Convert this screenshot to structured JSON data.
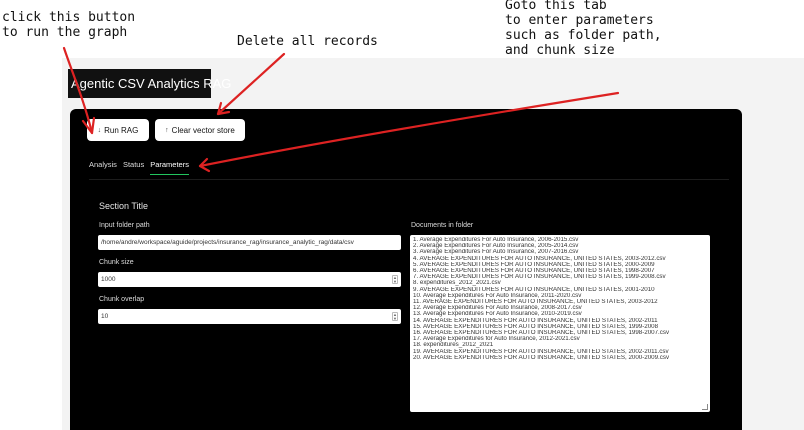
{
  "annotations": {
    "run": "click this button\nto run the graph",
    "delete": "Delete all records",
    "params": "Goto this tab\nto enter parameters\nsuch as folder path,\nand chunk size"
  },
  "app": {
    "title": "Agentic CSV Analytics RAG",
    "buttons": {
      "run_rag": "Run RAG",
      "run_rag_icon": "↓",
      "clear": "Clear vector store",
      "clear_icon": "↑"
    },
    "tabs": [
      {
        "label": "Analysis",
        "active": false
      },
      {
        "label": "Status",
        "active": false
      },
      {
        "label": "Parameters",
        "active": true
      }
    ],
    "section_title": "Section Title",
    "fields": {
      "folder_label": "Input folder path",
      "folder_value": "/home/andre/workspace/aguide/projects/insurance_rag/insurance_analytic_rag/data/csv",
      "chunk_size_label": "Chunk size",
      "chunk_size_value": "1000",
      "chunk_overlap_label": "Chunk overlap",
      "chunk_overlap_value": "10"
    },
    "documents_label": "Documents in folder",
    "documents": [
      "1. Average Expenditures For Auto Insurance, 2006-2015.csv",
      "2. Average Expenditures For Auto Insurance, 2005-2014.csv",
      "3. Average Expenditures For Auto Insurance, 2007-2016.csv",
      "4. AVERAGE EXPENDITURES FOR AUTO INSURANCE, UNITED STATES, 2003-2012.csv",
      "5. AVERAGE EXPENDITURES FOR AUTO INSURANCE, UNITED STATES, 2000-2009",
      "6. AVERAGE EXPENDITURES FOR AUTO INSURANCE, UNITED STATES, 1998-2007",
      "7. AVERAGE EXPENDITURES FOR AUTO INSURANCE, UNITED STATES, 1999-2008.csv",
      "8. expenditures_2012_2021.csv",
      "9. AVERAGE EXPENDITURES FOR AUTO INSURANCE, UNITED STATES, 2001-2010",
      "10. Average Expenditures For Auto Insurance, 2011-2020.csv",
      "11. AVERAGE EXPENDITURES FOR AUTO INSURANCE, UNITED STATES, 2003-2012",
      "12. Average Expenditures For Auto Insurance, 2008-2017.csv",
      "13. Average Expenditures For Auto Insurance, 2010-2019.csv",
      "14. AVERAGE EXPENDITURES FOR AUTO INSURANCE, UNITED STATES, 2002-2011",
      "15. AVERAGE EXPENDITURES FOR AUTO INSURANCE, UNITED STATES, 1999-2008",
      "16. AVERAGE EXPENDITURES FOR AUTO INSURANCE, UNITED STATES, 1998-2007.csv",
      "17. Average Expenditures for Auto Insurance, 2012-2021.csv",
      "18. expenditures_2012_2021",
      "19. AVERAGE EXPENDITURES FOR AUTO INSURANCE, UNITED STATES, 2002-2011.csv",
      "20. AVERAGE EXPENDITURES FOR AUTO INSURANCE, UNITED STATES, 2000-2009.csv"
    ]
  }
}
